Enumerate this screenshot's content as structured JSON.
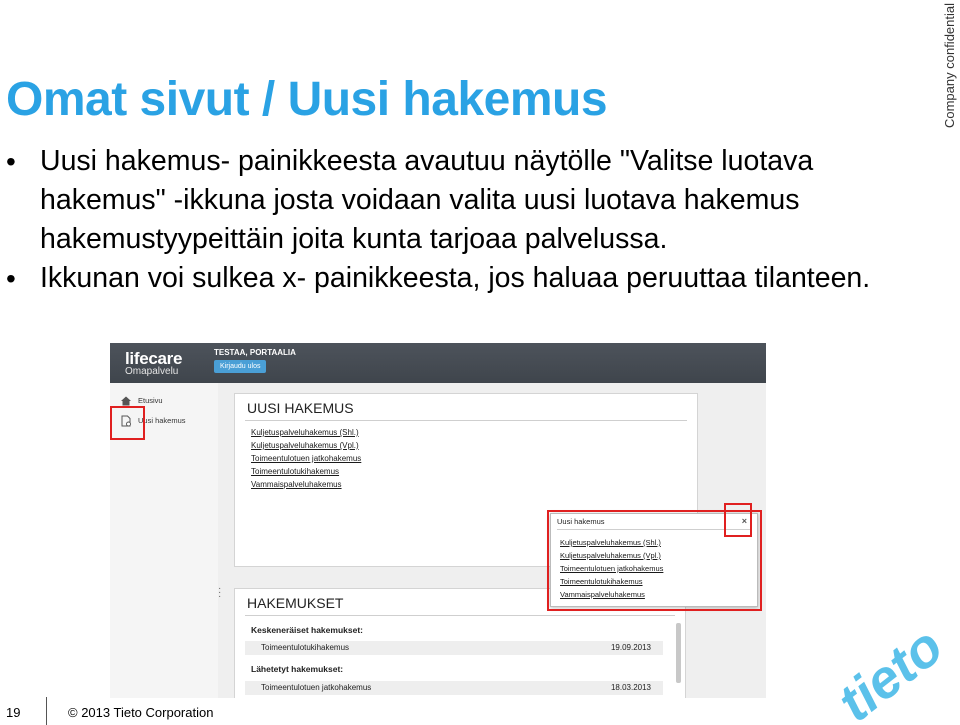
{
  "slide": {
    "title": "Omat sivut / Uusi hakemus",
    "confidential": "Company confidential",
    "bullets": [
      "Uusi hakemus- painikkeesta avautuu näytölle \"Valitse luotava hakemus\" -ikkuna josta voidaan valita uusi luotava hakemus hakemustyypeittäin joita kunta tarjoaa palvelussa.",
      "Ikkunan voi sulkea x- painikkeesta, jos haluaa peruuttaa tilanteen."
    ],
    "page_number": "19",
    "copyright": "© 2013 Tieto Corporation",
    "logo_text": "tieto",
    "accent_color": "#2aa2e4",
    "highlight_color": "#e02020"
  },
  "app": {
    "logo": "lifecare",
    "logo_sub": "Omapalvelu",
    "user_name": "TESTAA, PORTAALIA",
    "logout": "Kirjaudu ulos",
    "sidebar": [
      {
        "label": "Etusivu",
        "icon": "home-icon"
      },
      {
        "label": "Uusi hakemus",
        "icon": "new-document-icon"
      }
    ],
    "new_app_card": {
      "title": "UUSI HAKEMUS",
      "links": [
        "Kuljetuspalveluhakemus (Shl.)",
        "Kuljetuspalveluhakemus (Vpl.)",
        "Toimeentulotuen jatkohakemus",
        "Toimeentulotukihakemus",
        "Vammaispalveluhakemus"
      ]
    },
    "dialog": {
      "title": "Uusi hakemus",
      "close": "×",
      "links": [
        "Kuljetuspalveluhakemus (Shl.)",
        "Kuljetuspalveluhakemus (Vpl.)",
        "Toimeentulotuen jatkohakemus",
        "Toimeentulotukihakemus",
        "Vammaispalveluhakemus"
      ]
    },
    "applications": {
      "title": "HAKEMUKSET",
      "pending_label": "Keskeneräiset hakemukset:",
      "pending": [
        {
          "name": "Toimeentulotukihakemus",
          "date": "19.09.2013"
        }
      ],
      "sent_label": "Lähetetyt hakemukset:",
      "sent": [
        {
          "name": "Toimeentulotuen jatkohakemus",
          "date": "18.03.2013"
        }
      ]
    }
  }
}
